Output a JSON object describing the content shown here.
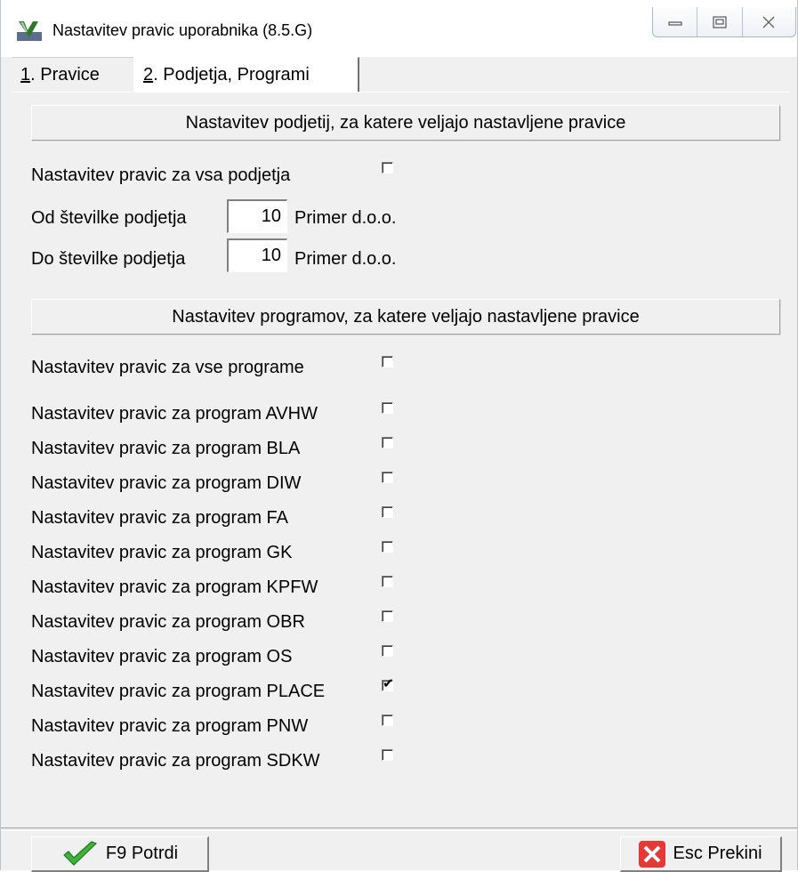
{
  "window": {
    "title": "Nastavitev pravic uporabnika  (8.5.G)",
    "icon": "app-logo-icon"
  },
  "tabs": [
    {
      "underline": "1",
      "rest": ". Pravice",
      "active": false
    },
    {
      "underline": "2",
      "rest": ". Podjetja, Programi",
      "active": true
    }
  ],
  "companies": {
    "heading": "Nastavitev podjetij, za katere veljajo nastavljene pravice",
    "all_label": "Nastavitev pravic za vsa podjetja",
    "all_checked": false,
    "from_label": "Od številke podjetja",
    "from_value": "10",
    "from_name": "Primer d.o.o.",
    "to_label": "Do številke podjetja",
    "to_value": "10",
    "to_name": "Primer d.o.o."
  },
  "programs": {
    "heading": "Nastavitev programov, za katere veljajo nastavljene pravice",
    "all_label": "Nastavitev pravic za vse programe",
    "all_checked": false,
    "items": [
      {
        "label": "Nastavitev pravic za program AVHW",
        "checked": false
      },
      {
        "label": "Nastavitev pravic za program BLA",
        "checked": false
      },
      {
        "label": "Nastavitev pravic za program DIW",
        "checked": false
      },
      {
        "label": "Nastavitev pravic za program FA",
        "checked": false
      },
      {
        "label": "Nastavitev pravic za program GK",
        "checked": false
      },
      {
        "label": "Nastavitev pravic za program KPFW",
        "checked": false
      },
      {
        "label": "Nastavitev pravic za program OBR",
        "checked": false
      },
      {
        "label": "Nastavitev pravic za program OS",
        "checked": false
      },
      {
        "label": "Nastavitev pravic za program PLACE",
        "checked": true
      },
      {
        "label": "Nastavitev pravic za program PNW",
        "checked": false
      },
      {
        "label": "Nastavitev pravic za program SDKW",
        "checked": false
      }
    ]
  },
  "buttons": {
    "confirm": "F9 Potrdi",
    "cancel": "Esc Prekini"
  },
  "colors": {
    "confirm_icon": "#3db33a",
    "cancel_icon": "#e53935"
  }
}
